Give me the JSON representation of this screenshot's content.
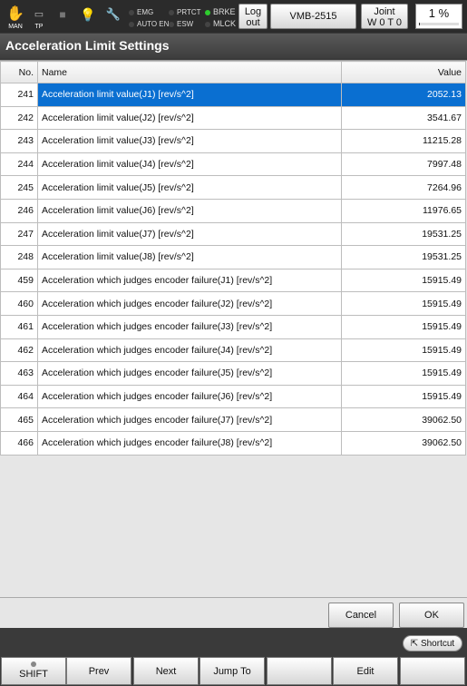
{
  "status": {
    "icons": [
      {
        "name": "MAN",
        "glyph": "✋"
      },
      {
        "name": "TP",
        "glyph": "▭"
      },
      {
        "name": "",
        "glyph": "■"
      },
      {
        "name": "",
        "glyph": "💡"
      },
      {
        "name": "",
        "glyph": "🔧"
      }
    ],
    "emg": "EMG",
    "auto_en": "AUTO EN",
    "prtct": "PRTCT",
    "esw": "ESW",
    "brke": "BRKE",
    "mlck": "MLCK",
    "logout_line1": "Log",
    "logout_line2": "out",
    "robot_model": "VMB-2515",
    "mode_line1": "Joint",
    "mode_line2": "W 0 T 0",
    "speed": "1 %"
  },
  "page_title": "Acceleration Limit Settings",
  "table": {
    "headers": {
      "no": "No.",
      "name": "Name",
      "value": "Value"
    },
    "rows": [
      {
        "no": "241",
        "name": "Acceleration limit value(J1) [rev/s^2]",
        "value": "2052.13"
      },
      {
        "no": "242",
        "name": "Acceleration limit value(J2) [rev/s^2]",
        "value": "3541.67"
      },
      {
        "no": "243",
        "name": "Acceleration limit value(J3) [rev/s^2]",
        "value": "11215.28"
      },
      {
        "no": "244",
        "name": "Acceleration limit value(J4) [rev/s^2]",
        "value": "7997.48"
      },
      {
        "no": "245",
        "name": "Acceleration limit value(J5) [rev/s^2]",
        "value": "7264.96"
      },
      {
        "no": "246",
        "name": "Acceleration limit value(J6) [rev/s^2]",
        "value": "11976.65"
      },
      {
        "no": "247",
        "name": "Acceleration limit value(J7) [rev/s^2]",
        "value": "19531.25"
      },
      {
        "no": "248",
        "name": "Acceleration limit value(J8) [rev/s^2]",
        "value": "19531.25"
      },
      {
        "no": "459",
        "name": "Acceleration which judges encoder failure(J1) [rev/s^2]",
        "value": "15915.49"
      },
      {
        "no": "460",
        "name": "Acceleration which judges encoder failure(J2) [rev/s^2]",
        "value": "15915.49"
      },
      {
        "no": "461",
        "name": "Acceleration which judges encoder failure(J3) [rev/s^2]",
        "value": "15915.49"
      },
      {
        "no": "462",
        "name": "Acceleration which judges encoder failure(J4) [rev/s^2]",
        "value": "15915.49"
      },
      {
        "no": "463",
        "name": "Acceleration which judges encoder failure(J5) [rev/s^2]",
        "value": "15915.49"
      },
      {
        "no": "464",
        "name": "Acceleration which judges encoder failure(J6) [rev/s^2]",
        "value": "15915.49"
      },
      {
        "no": "465",
        "name": "Acceleration which judges encoder failure(J7) [rev/s^2]",
        "value": "39062.50"
      },
      {
        "no": "466",
        "name": "Acceleration which judges encoder failure(J8) [rev/s^2]",
        "value": "39062.50"
      }
    ]
  },
  "buttons": {
    "cancel": "Cancel",
    "ok": "OK",
    "shortcut": "Shortcut"
  },
  "softkeys": [
    "SHIFT",
    "Prev",
    "Next",
    "Jump To",
    "",
    "Edit",
    ""
  ],
  "colors": {
    "selection": "#0a6fd1",
    "brake_indicator": "#2ecc2e"
  }
}
